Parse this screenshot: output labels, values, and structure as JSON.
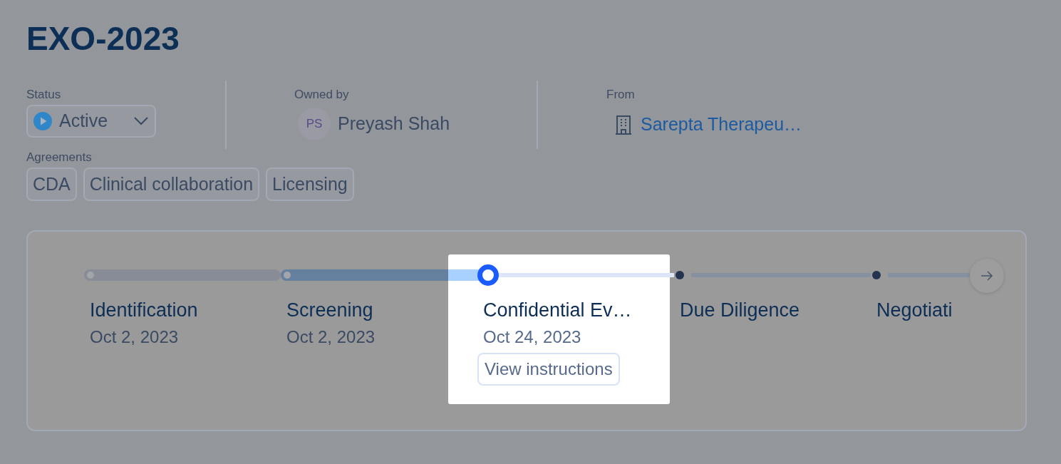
{
  "title": "EXO-2023",
  "status": {
    "label": "Status",
    "value": "Active"
  },
  "owner": {
    "label": "Owned by",
    "initials": "PS",
    "name": "Preyash Shah"
  },
  "from": {
    "label": "From",
    "company": "Sarepta Therapeu…"
  },
  "agreements": {
    "label": "Agreements",
    "items": [
      "CDA",
      "Clinical collaboration",
      "Licensing"
    ]
  },
  "stages": [
    {
      "name": "Identification",
      "date": "Oct 2, 2023",
      "completed": true,
      "selected": false
    },
    {
      "name": "Screening",
      "date": "Oct 2, 2023",
      "completed": true,
      "selected": false
    },
    {
      "name": "Confidential Ev…",
      "date": "Oct 24, 2023",
      "completed": false,
      "selected": true,
      "action": "View instructions"
    },
    {
      "name": "Due Diligence",
      "completed": false,
      "selected": false
    },
    {
      "name": "Negotiati",
      "completed": false,
      "selected": false
    }
  ]
}
